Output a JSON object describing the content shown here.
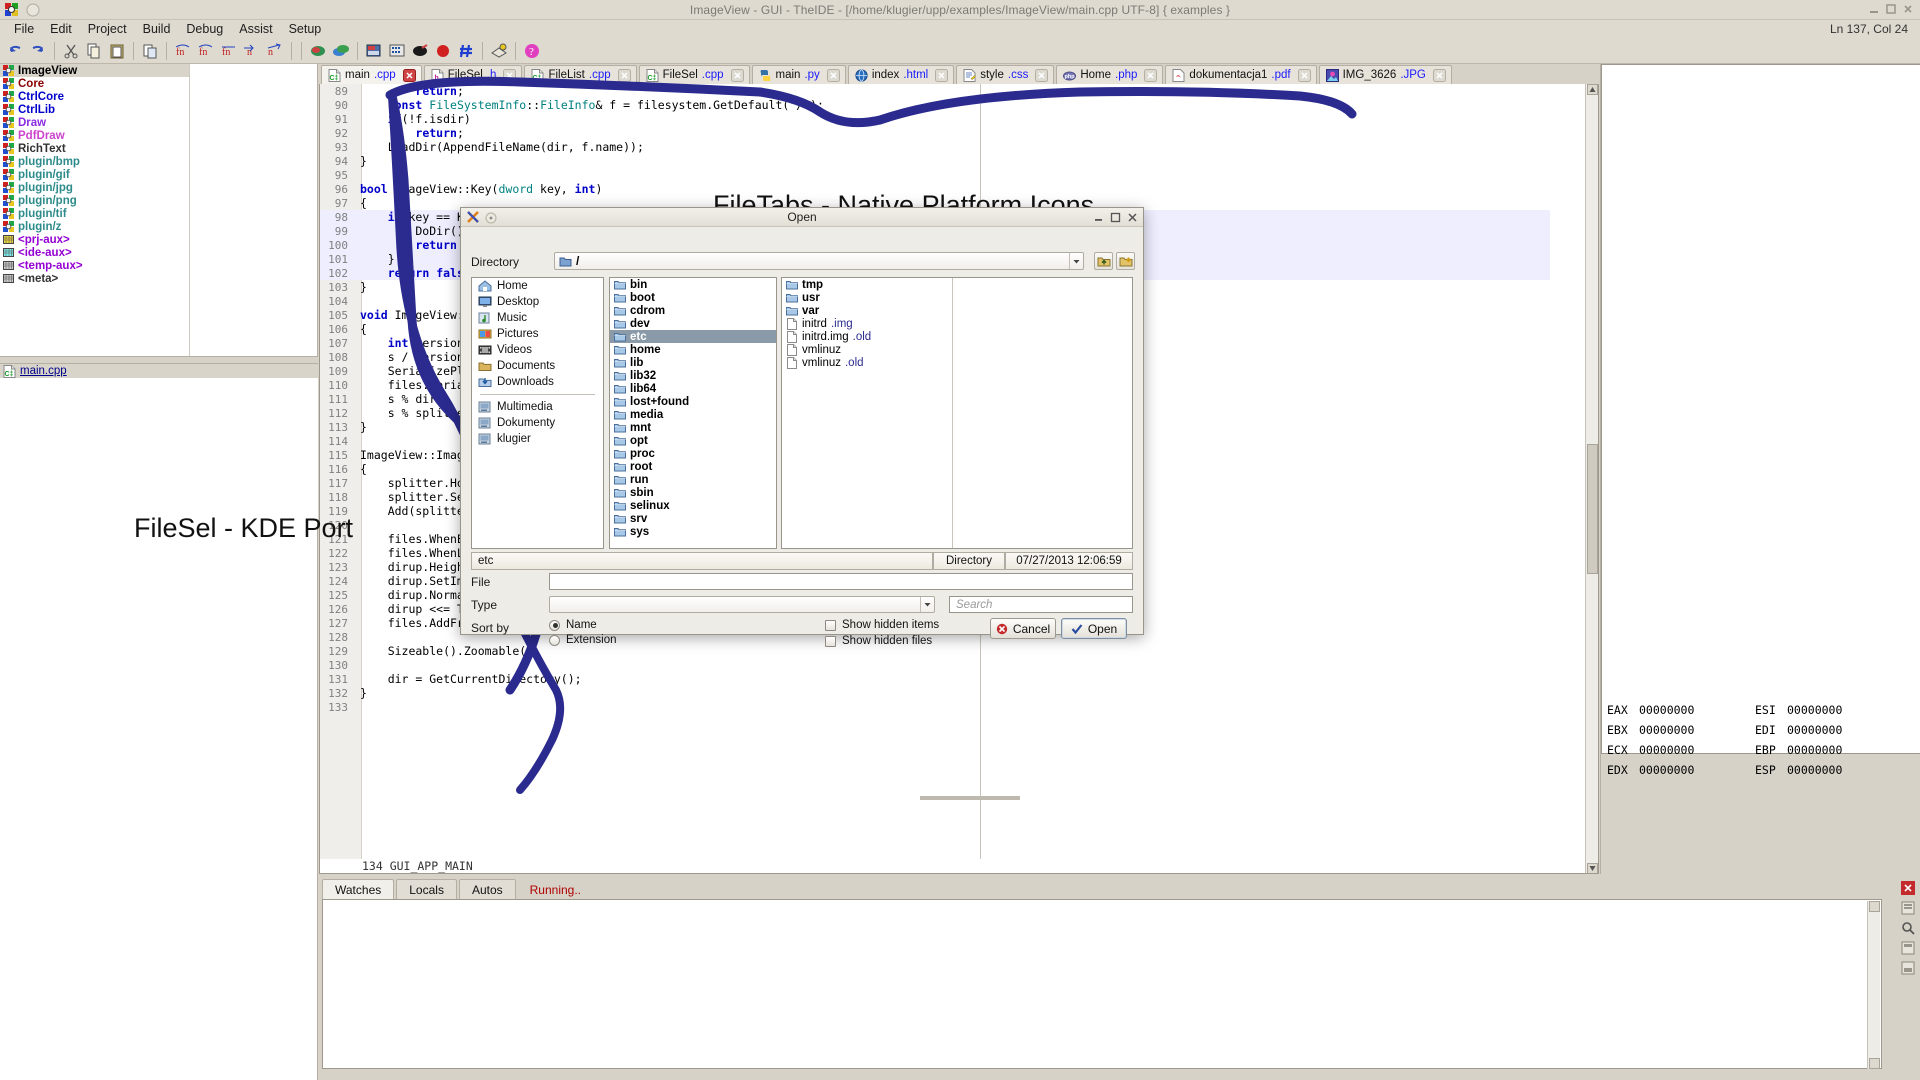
{
  "window": {
    "title": "ImageView - GUI - TheIDE - [/home/klugier/upp/examples/ImageView/main.cpp UTF-8] { examples }",
    "status_right": "Ln 137, Col 24",
    "buttons": [
      "minimize",
      "maximize",
      "close"
    ]
  },
  "menubar": {
    "items": [
      {
        "label": "File",
        "name": "menu-file"
      },
      {
        "label": "Edit",
        "name": "menu-edit"
      },
      {
        "label": "Project",
        "name": "menu-project"
      },
      {
        "label": "Build",
        "name": "menu-build"
      },
      {
        "label": "Debug",
        "name": "menu-debug"
      },
      {
        "label": "Assist",
        "name": "menu-assist"
      },
      {
        "label": "Setup",
        "name": "menu-setup"
      }
    ]
  },
  "toolbar": {
    "icons": [
      "undo-icon",
      "redo-icon",
      "cut-icon",
      "copy-icon",
      "paste-icon",
      "duplicate-icon",
      "find-icon",
      "find-replace-icon",
      "find-prev-icon",
      "goto-icon",
      "find-next-icon",
      "build-icon",
      "build-and-run-icon",
      "debug-icon",
      "calculator-icon",
      "pencil-icon",
      "stop-icon",
      "hash-icon",
      "package-icon",
      "help-icon"
    ]
  },
  "package_tree": {
    "selected": "ImageView",
    "items": [
      {
        "label": "ImageView",
        "color": "#000000",
        "icon": "package-icon",
        "selected": true
      },
      {
        "label": "Core",
        "color": "#8b0000",
        "icon": "package-icon"
      },
      {
        "label": "CtrlCore",
        "color": "#0000cd",
        "icon": "package-icon"
      },
      {
        "label": "CtrlLib",
        "color": "#0000cd",
        "icon": "package-icon"
      },
      {
        "label": "Draw",
        "color": "#8a2be2",
        "icon": "package-icon"
      },
      {
        "label": "PdfDraw",
        "color": "#cc44cc",
        "icon": "package-icon"
      },
      {
        "label": "RichText",
        "color": "#333333",
        "icon": "package-icon"
      },
      {
        "label": "plugin/bmp",
        "color": "#2e8b8b",
        "icon": "package-icon"
      },
      {
        "label": "plugin/gif",
        "color": "#2e8b8b",
        "icon": "package-icon"
      },
      {
        "label": "plugin/jpg",
        "color": "#2e8b8b",
        "icon": "package-icon"
      },
      {
        "label": "plugin/png",
        "color": "#2e8b8b",
        "icon": "package-icon"
      },
      {
        "label": "plugin/tif",
        "color": "#2e8b8b",
        "icon": "package-icon"
      },
      {
        "label": "plugin/z",
        "color": "#2e8b8b",
        "icon": "package-icon"
      },
      {
        "label": "<prj-aux>",
        "color": "#9400d3",
        "icon": "aux-icon-yellow"
      },
      {
        "label": "<ide-aux>",
        "color": "#9400d3",
        "icon": "aux-icon-cyan"
      },
      {
        "label": "<temp-aux>",
        "color": "#9400d3",
        "icon": "aux-icon-gray"
      },
      {
        "label": "<meta>",
        "color": "#333333",
        "icon": "aux-icon-gray"
      }
    ]
  },
  "file_tree": {
    "items": [
      {
        "label": "main.cpp",
        "icon": "cpp-file-icon",
        "selected": true
      }
    ]
  },
  "file_tabs": {
    "items": [
      {
        "name": "main",
        "ext": ".cpp",
        "icon": "cpp-file-icon",
        "active": true,
        "close": "close-icon-red"
      },
      {
        "name": "FileSel",
        "ext": ".h",
        "icon": "h-file-icon",
        "active": false,
        "close": "close-icon"
      },
      {
        "name": "FileList",
        "ext": ".cpp",
        "icon": "cpp-file-icon",
        "active": false,
        "close": "close-icon"
      },
      {
        "name": "FileSel",
        "ext": ".cpp",
        "icon": "cpp-file-icon",
        "active": false,
        "close": "close-icon"
      },
      {
        "name": "main",
        "ext": ".py",
        "icon": "python-file-icon",
        "active": false,
        "close": "close-icon"
      },
      {
        "name": "index",
        "ext": ".html",
        "icon": "html-file-icon",
        "active": false,
        "close": "close-icon"
      },
      {
        "name": "style",
        "ext": ".css",
        "icon": "css-file-icon",
        "active": false,
        "close": "close-icon"
      },
      {
        "name": "Home",
        "ext": ".php",
        "icon": "php-file-icon",
        "active": false,
        "close": "close-icon"
      },
      {
        "name": "dokumentacja1",
        "ext": ".pdf",
        "icon": "pdf-file-icon",
        "active": false,
        "close": "close-icon"
      },
      {
        "name": "IMG_3626",
        "ext": ".JPG",
        "icon": "jpg-file-icon",
        "active": false,
        "close": "close-icon"
      }
    ]
  },
  "editor": {
    "lines": [
      {
        "n": "89",
        "text": "        return;"
      },
      {
        "n": "90",
        "text": "    const FileSystemInfo::FileInfo& f = filesystem.GetDefault(\"/\");"
      },
      {
        "n": "91",
        "text": "    if(!f.isdir)"
      },
      {
        "n": "92",
        "text": "        return;"
      },
      {
        "n": "93",
        "text": "    LoadDir(AppendFileName(dir, f.name));"
      },
      {
        "n": "94",
        "text": "}"
      },
      {
        "n": "95",
        "text": ""
      },
      {
        "n": "96",
        "text": "bool ImageView::Key(dword key, int)"
      },
      {
        "n": "97",
        "text": "{"
      },
      {
        "n": "98",
        "text": "    if(key == K_ENTER) {"
      },
      {
        "n": "99",
        "text": "        DoDir();"
      },
      {
        "n": "100",
        "text": "        return true;"
      },
      {
        "n": "101",
        "text": "    }"
      },
      {
        "n": "102",
        "text": "    return false;"
      },
      {
        "n": "103",
        "text": "}"
      },
      {
        "n": "104",
        "text": ""
      },
      {
        "n": "105",
        "text": "void ImageView::Serialize(Stream& s)"
      },
      {
        "n": "106",
        "text": "{"
      },
      {
        "n": "107",
        "text": "    int version = 0;"
      },
      {
        "n": "108",
        "text": "    s / version;"
      },
      {
        "n": "109",
        "text": "    SerializePlacement(s);"
      },
      {
        "n": "110",
        "text": "    files.SerializeSettings(s);"
      },
      {
        "n": "111",
        "text": "    s % dir;"
      },
      {
        "n": "112",
        "text": "    s % splitter;"
      },
      {
        "n": "113",
        "text": "}"
      },
      {
        "n": "114",
        "text": ""
      },
      {
        "n": "115",
        "text": "ImageView::ImageView()"
      },
      {
        "n": "116",
        "text": "{"
      },
      {
        "n": "117",
        "text": "    splitter.Horz();"
      },
      {
        "n": "118",
        "text": "    splitter.SetPos(2000);"
      },
      {
        "n": "119",
        "text": "    Add(splitter.SizePos());"
      },
      {
        "n": "120",
        "text": ""
      },
      {
        "n": "121",
        "text": "    files.WhenEnterItem = THISBACK(DoFile);"
      },
      {
        "n": "122",
        "text": "    files.WhenLeftDouble = THISBACK(DoDir);"
      },
      {
        "n": "123",
        "text": "    dirup.Height(20);"
      },
      {
        "n": "124",
        "text": "    dirup.SetImage(CtrlImg::DirUp());"
      },
      {
        "n": "125",
        "text": "    dirup.NormalStyle();"
      },
      {
        "n": "126",
        "text": "    dirup <<= THISBACK(DirUp);"
      },
      {
        "n": "127",
        "text": "    files.AddFrame(dirup);"
      },
      {
        "n": "128",
        "text": ""
      },
      {
        "n": "129",
        "text": "    Sizeable().Zoomable();"
      },
      {
        "n": "130",
        "text": ""
      },
      {
        "n": "131",
        "text": "    dir = GetCurrentDirectory();"
      },
      {
        "n": "132",
        "text": "}"
      },
      {
        "n": "133",
        "text": ""
      }
    ],
    "status": "134 GUI_APP_MAIN"
  },
  "registers": {
    "rows": [
      {
        "name": "EAX",
        "value": "00000000",
        "name2": "ESI",
        "value2": "00000000"
      },
      {
        "name": "EBX",
        "value": "00000000",
        "name2": "EDI",
        "value2": "00000000"
      },
      {
        "name": "ECX",
        "value": "00000000",
        "name2": "EBP",
        "value2": "00000000"
      },
      {
        "name": "EDX",
        "value": "00000000",
        "name2": "ESP",
        "value2": "00000000"
      }
    ]
  },
  "bottom_panel": {
    "tabs": [
      {
        "label": "Watches",
        "active": true
      },
      {
        "label": "Locals",
        "active": false
      },
      {
        "label": "Autos",
        "active": false
      }
    ],
    "running_label": "Running..",
    "tool_icons": [
      "close-icon-red",
      "copy-icon",
      "zoom-icon",
      "maximize-icon",
      "restore-icon"
    ]
  },
  "annotations": [
    {
      "text": "FileTabs - Native Platform Icons",
      "name": "annotation-filetabs"
    },
    {
      "text": "FileSel - KDE Port",
      "name": "annotation-filesel"
    }
  ],
  "file_dialog": {
    "title": "Open",
    "title_icons": [
      "app-icon",
      "circle-icon"
    ],
    "window_buttons": [
      "minimize",
      "maximize",
      "close"
    ],
    "directory_label": "Directory",
    "directory_value": "/",
    "updir_icon": "up-folder-icon",
    "newdir_icon": "new-folder-icon",
    "places": [
      {
        "label": "Home",
        "icon": "home-icon"
      },
      {
        "label": "Desktop",
        "icon": "desktop-icon"
      },
      {
        "label": "Music",
        "icon": "music-icon"
      },
      {
        "label": "Pictures",
        "icon": "pictures-icon"
      },
      {
        "label": "Videos",
        "icon": "videos-icon"
      },
      {
        "label": "Documents",
        "icon": "documents-icon"
      },
      {
        "label": "Downloads",
        "icon": "downloads-icon"
      },
      {
        "separator": true
      },
      {
        "label": "Multimedia",
        "icon": "drive-icon"
      },
      {
        "label": "Dokumenty",
        "icon": "drive-icon"
      },
      {
        "label": "klugier",
        "icon": "drive-icon"
      }
    ],
    "directories": [
      {
        "label": "bin",
        "selected": false
      },
      {
        "label": "boot",
        "selected": false
      },
      {
        "label": "cdrom",
        "selected": false
      },
      {
        "label": "dev",
        "selected": false
      },
      {
        "label": "etc",
        "selected": true
      },
      {
        "label": "home",
        "selected": false
      },
      {
        "label": "lib",
        "selected": false
      },
      {
        "label": "lib32",
        "selected": false
      },
      {
        "label": "lib64",
        "selected": false
      },
      {
        "label": "lost+found",
        "selected": false
      },
      {
        "label": "media",
        "selected": false
      },
      {
        "label": "mnt",
        "selected": false
      },
      {
        "label": "opt",
        "selected": false
      },
      {
        "label": "proc",
        "selected": false
      },
      {
        "label": "root",
        "selected": false
      },
      {
        "label": "run",
        "selected": false
      },
      {
        "label": "sbin",
        "selected": false
      },
      {
        "label": "selinux",
        "selected": false
      },
      {
        "label": "srv",
        "selected": false
      },
      {
        "label": "sys",
        "selected": false
      }
    ],
    "files_col": [
      {
        "label": "tmp",
        "type": "dir"
      },
      {
        "label": "usr",
        "type": "dir"
      },
      {
        "label": "var",
        "type": "dir"
      },
      {
        "label": "initrd",
        "ext": ".img",
        "type": "file"
      },
      {
        "label": "initrd.img",
        "ext": ".old",
        "type": "file"
      },
      {
        "label": "vmlinuz",
        "ext": "",
        "type": "file"
      },
      {
        "label": "vmlinuz",
        "ext": ".old",
        "type": "file"
      }
    ],
    "status": {
      "name": "etc",
      "kind": "Directory",
      "datetime": "07/27/2013 12:06:59"
    },
    "file_label": "File",
    "file_value": "",
    "type_label": "Type",
    "type_value": "",
    "search_placeholder": "Search",
    "sort_label": "Sort by",
    "sort_options": [
      {
        "label": "Name",
        "selected": true
      },
      {
        "label": "Extension",
        "selected": false
      }
    ],
    "checkboxes": [
      {
        "label": "Show hidden items",
        "checked": false
      },
      {
        "label": "Show hidden files",
        "checked": false
      }
    ],
    "cancel_label": "Cancel",
    "open_label": "Open"
  }
}
